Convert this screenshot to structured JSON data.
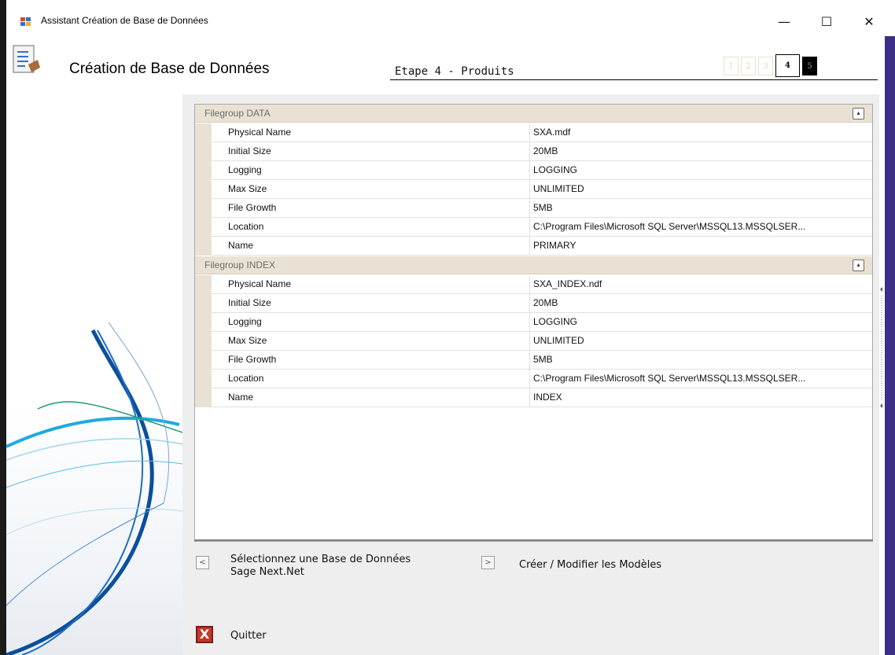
{
  "window": {
    "title": "Assistant Création de Base de Données",
    "min_icon": "—",
    "max_icon": "☐",
    "close_icon": "✕"
  },
  "header": {
    "title": "Création de Base de Données",
    "step_label": "Etape 4 - Produits",
    "steps": [
      "1",
      "2",
      "3",
      "4",
      "5"
    ],
    "current_step": "4"
  },
  "grid": {
    "groups": [
      {
        "label": "Filegroup DATA",
        "collapse_glyph": "▴",
        "rows": [
          {
            "name": "Physical Name",
            "value": "SXA.mdf"
          },
          {
            "name": "Initial Size",
            "value": "20MB"
          },
          {
            "name": "Logging",
            "value": "LOGGING"
          },
          {
            "name": "Max Size",
            "value": "UNLIMITED"
          },
          {
            "name": "File Growth",
            "value": "5MB"
          },
          {
            "name": "Location",
            "value": "C:\\Program Files\\Microsoft SQL Server\\MSSQL13.MSSQLSER..."
          },
          {
            "name": "Name",
            "value": "PRIMARY"
          }
        ]
      },
      {
        "label": "Filegroup INDEX",
        "collapse_glyph": "▴",
        "rows": [
          {
            "name": "Physical Name",
            "value": "SXA_INDEX.ndf"
          },
          {
            "name": "Initial Size",
            "value": "20MB"
          },
          {
            "name": "Logging",
            "value": "LOGGING"
          },
          {
            "name": "Max Size",
            "value": "UNLIMITED"
          },
          {
            "name": "File Growth",
            "value": "5MB"
          },
          {
            "name": "Location",
            "value": "C:\\Program Files\\Microsoft SQL Server\\MSSQL13.MSSQLSER..."
          },
          {
            "name": "Name",
            "value": "INDEX"
          }
        ]
      }
    ]
  },
  "nav": {
    "prev_glyph": "<",
    "prev_line1": "Sélectionnez une Base de Données",
    "prev_line2": "Sage Next.Net",
    "next_glyph": ">",
    "next_label": "Créer / Modifier les Modèles"
  },
  "quit": {
    "glyph": "X",
    "label": "Quitter"
  },
  "colors": {
    "category_bg": "#e9e2d4",
    "accent_strip": "#3b2f8a",
    "quit_red": "#c0392b"
  }
}
